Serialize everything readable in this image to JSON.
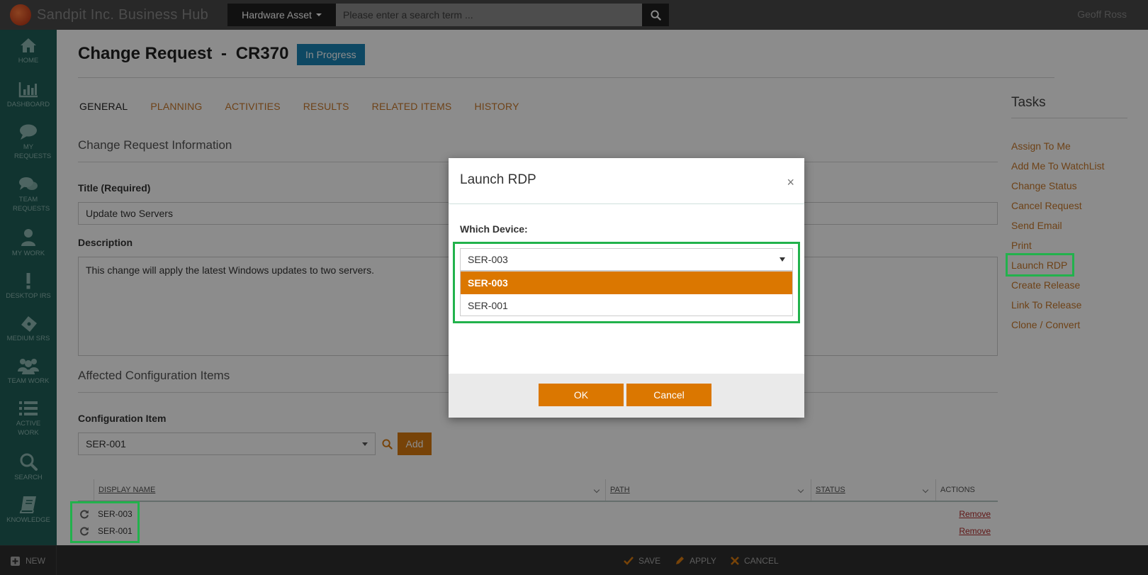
{
  "app": {
    "name": "Sandpit Inc. Business Hub",
    "user": "Geoff Ross"
  },
  "search": {
    "type_label": "Hardware Asset",
    "placeholder": "Please enter a search term ..."
  },
  "nav": [
    {
      "label": "HOME",
      "icon": "home-icon"
    },
    {
      "label": "DASHBOARD",
      "icon": "bar-chart-icon"
    },
    {
      "label": "MY REQUESTS",
      "icon": "speech-bubble-icon"
    },
    {
      "label": "TEAM REQUESTS",
      "icon": "speech-bubbles-icon"
    },
    {
      "label": "MY WORK",
      "icon": "person-icon"
    },
    {
      "label": "DESKTOP IRS",
      "icon": "exclamation-icon"
    },
    {
      "label": "MEDIUM SRS",
      "icon": "ticket-icon"
    },
    {
      "label": "TEAM WORK",
      "icon": "group-icon"
    },
    {
      "label": "ACTIVE WORK",
      "icon": "list-icon"
    },
    {
      "label": "SEARCH",
      "icon": "search-icon"
    },
    {
      "label": "KNOWLEDGE",
      "icon": "book-icon"
    }
  ],
  "page": {
    "title_prefix": "Change Request",
    "separator": "-",
    "request_id": "CR370",
    "status": "In Progress"
  },
  "tabs": [
    "GENERAL",
    "PLANNING",
    "ACTIVITIES",
    "RESULTS",
    "RELATED ITEMS",
    "HISTORY"
  ],
  "form": {
    "section_info": "Change Request Information",
    "title_label": "Title (Required)",
    "title_value": "Update two Servers",
    "description_label": "Description",
    "description_value": "This change will apply the latest Windows updates to two servers.",
    "section_ci": "Affected Configuration Items",
    "ci_label": "Configuration Item",
    "ci_value": "SER-001",
    "add_label": "Add"
  },
  "grid": {
    "columns": [
      "DISPLAY NAME",
      "PATH",
      "STATUS",
      "ACTIONS"
    ],
    "rows": [
      {
        "name": "SER-003",
        "action": "Remove"
      },
      {
        "name": "SER-001",
        "action": "Remove"
      }
    ]
  },
  "tasks": {
    "heading": "Tasks",
    "items": [
      "Assign To Me",
      "Add Me To WatchList",
      "Change Status",
      "Cancel Request",
      "Send Email",
      "Print",
      "Launch RDP",
      "Create Release",
      "Link To Release",
      "Clone / Convert"
    ]
  },
  "bottombar": {
    "new": "NEW",
    "save": "SAVE",
    "apply": "APPLY",
    "cancel": "CANCEL"
  },
  "modal": {
    "title": "Launch RDP",
    "close": "×",
    "device_label": "Which Device:",
    "selected": "SER-003",
    "options": [
      "SER-003",
      "SER-001"
    ],
    "ok": "OK",
    "cancel": "Cancel"
  },
  "colors": {
    "accent": "#db7700",
    "nav_bg": "#1f6058",
    "status_badge": "#1a84b4",
    "highlight": "#22b24c",
    "link": "#c8782a"
  }
}
